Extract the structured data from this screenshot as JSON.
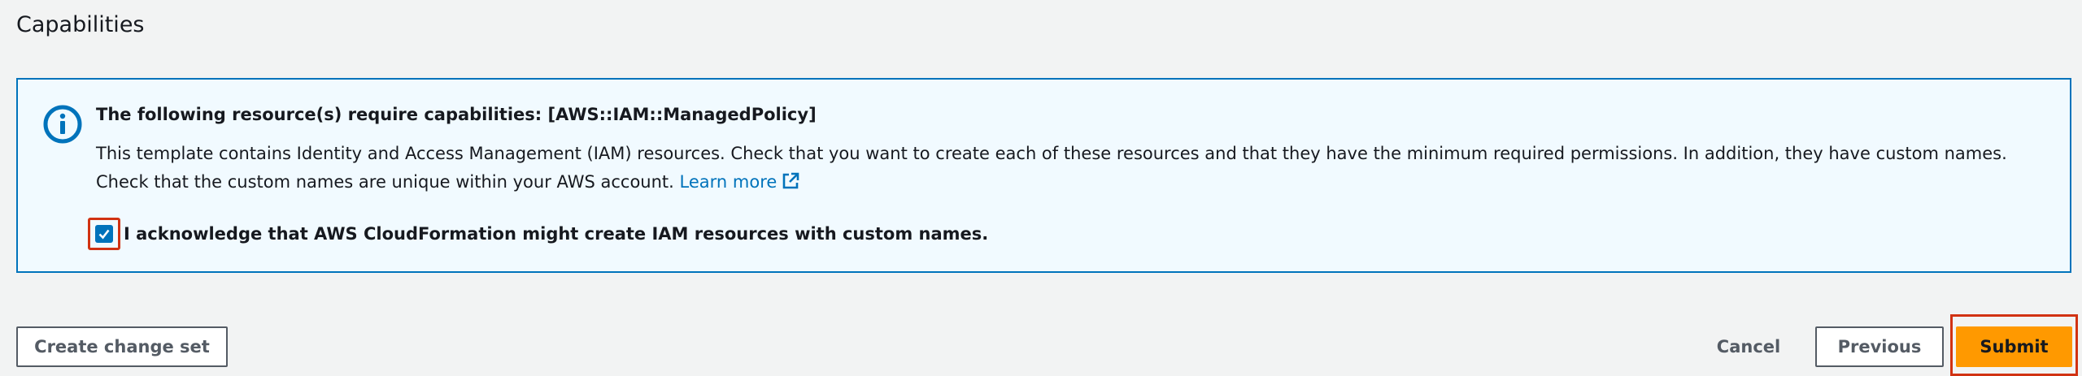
{
  "section": {
    "title": "Capabilities"
  },
  "info": {
    "icon": "info-circle-icon",
    "heading": "The following resource(s) require capabilities: [AWS::IAM::ManagedPolicy]",
    "body": "This template contains Identity and Access Management (IAM) resources. Check that you want to create each of these resources and that they have the minimum required permissions. In addition, they have custom names. Check that the custom names are unique within your AWS account.",
    "learn_more": "Learn more",
    "learn_more_icon": "external-link-icon",
    "accent_color": "#0073bb",
    "background_color": "#f1faff"
  },
  "acknowledge": {
    "label": "I acknowledge that AWS CloudFormation might create IAM resources with custom names.",
    "checked": true
  },
  "footer": {
    "create_change_set": "Create change set",
    "cancel": "Cancel",
    "previous": "Previous",
    "submit": "Submit",
    "submit_color": "#ff9900",
    "highlight_color": "#d13212"
  }
}
